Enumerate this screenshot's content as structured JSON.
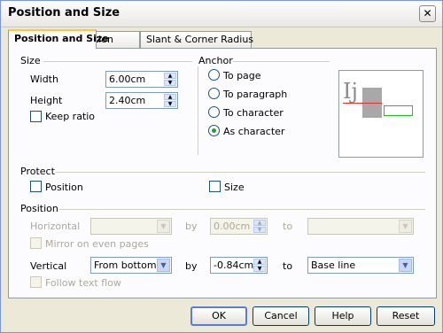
{
  "dialog": {
    "title": "Position and Size",
    "close_glyph": "✕"
  },
  "tabs": [
    {
      "label": "Position and Size"
    },
    {
      "label": "Rotation"
    },
    {
      "label": "Slant & Corner Radius"
    }
  ],
  "size": {
    "header": "Size",
    "width_label": "Width",
    "width_value": "6.00cm",
    "height_label": "Height",
    "height_value": "2.40cm",
    "keep_ratio_label": "Keep ratio",
    "keep_ratio_checked": false
  },
  "anchor": {
    "header": "Anchor",
    "options": [
      {
        "label": "To page",
        "selected": false
      },
      {
        "label": "To paragraph",
        "selected": false
      },
      {
        "label": "To character",
        "selected": false
      },
      {
        "label": "As character",
        "selected": true
      }
    ],
    "preview_text": "Ij"
  },
  "protect": {
    "header": "Protect",
    "position_label": "Position",
    "position_checked": false,
    "size_label": "Size",
    "size_checked": false
  },
  "position": {
    "header": "Position",
    "horizontal_label": "Horizontal",
    "horizontal_value": "",
    "h_by_label": "by",
    "h_by_value": "0.00cm",
    "h_to_label": "to",
    "h_to_value": "",
    "mirror_label": "Mirror on even pages",
    "vertical_label": "Vertical",
    "vertical_value": "From bottom",
    "v_by_label": "by",
    "v_by_value": "-0.84cm",
    "v_to_label": "to",
    "v_to_value": "Base line",
    "follow_label": "Follow text flow"
  },
  "buttons": {
    "ok": "OK",
    "cancel": "Cancel",
    "help": "Help",
    "reset": "Reset"
  },
  "colors": {
    "accent": "#FFC83C",
    "radio_dot": "#21A121",
    "preview_line": "#E03030",
    "preview_box": "#21C121"
  }
}
